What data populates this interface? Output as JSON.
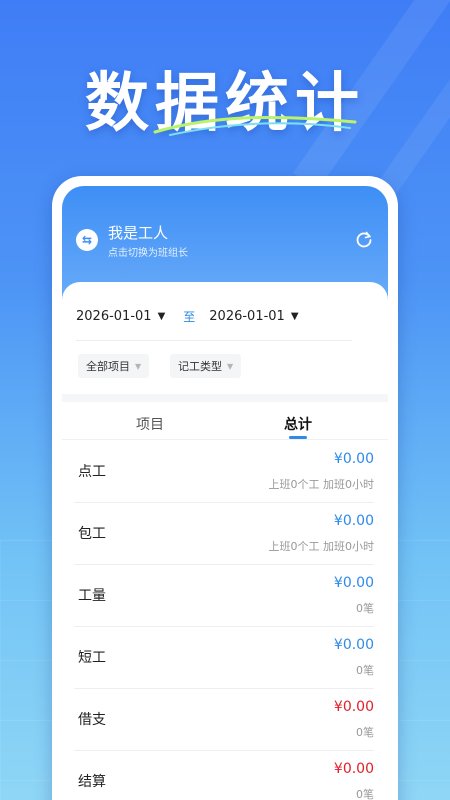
{
  "hero": {
    "title": "数据统计"
  },
  "header": {
    "role_title": "我是工人",
    "role_subtitle": "点击切换为班组长",
    "switch_icon": "swap-icon",
    "refresh_icon": "refresh-icon"
  },
  "filters": {
    "start_date": "2026-01-01",
    "separator": "至",
    "end_date": "2026-01-01",
    "project_filter": "全部项目",
    "type_filter": "记工类型"
  },
  "tabs": [
    {
      "label": "项目",
      "active": false
    },
    {
      "label": "总计",
      "active": true
    }
  ],
  "rows": [
    {
      "label": "点工",
      "amount": "¥0.00",
      "sub": "上班0个工 加班0小时",
      "color": "#2f8ae8"
    },
    {
      "label": "包工",
      "amount": "¥0.00",
      "sub": "上班0个工 加班0小时",
      "color": "#2f8ae8"
    },
    {
      "label": "工量",
      "amount": "¥0.00",
      "sub": "0笔",
      "color": "#2f8ae8"
    },
    {
      "label": "短工",
      "amount": "¥0.00",
      "sub": "0笔",
      "color": "#2f8ae8"
    },
    {
      "label": "借支",
      "amount": "¥0.00",
      "sub": "0笔",
      "color": "#e0202a"
    },
    {
      "label": "结算",
      "amount": "¥0.00",
      "sub": "0笔",
      "color": "#e0202a"
    }
  ],
  "colors": {
    "accent": "#2f8ae8",
    "expense": "#e0202a",
    "bg_top": "#3f7df6"
  }
}
